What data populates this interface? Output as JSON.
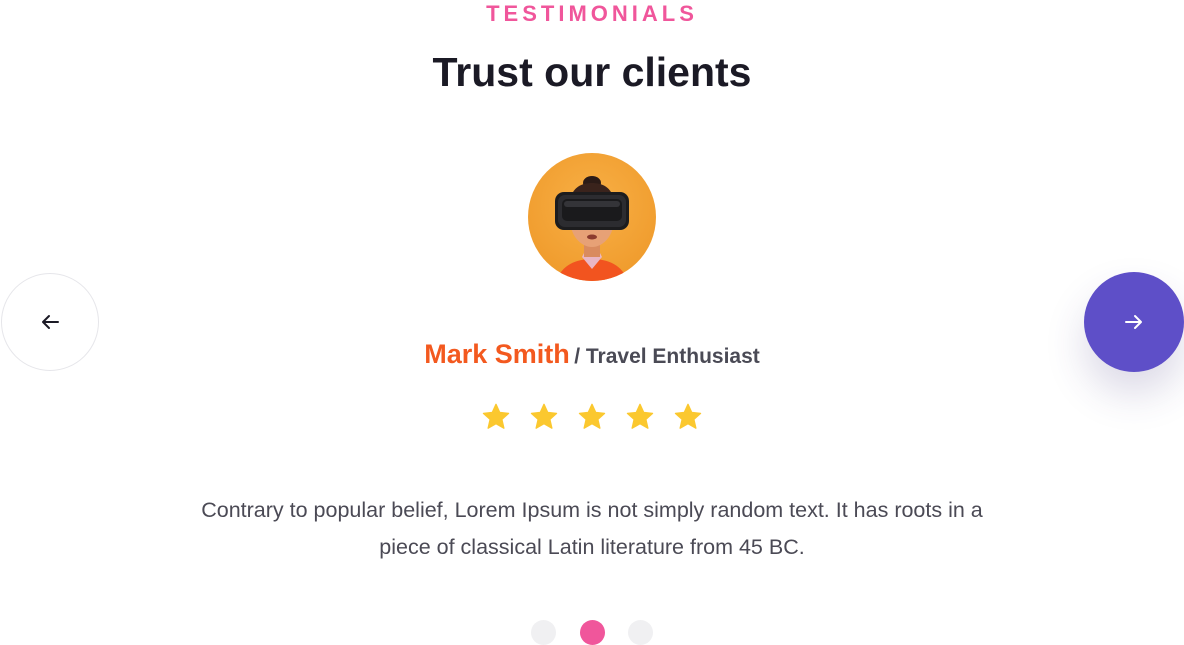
{
  "section": {
    "eyebrow": "TESTIMONIALS",
    "title": "Trust our clients"
  },
  "testimonial": {
    "name": "Mark Smith",
    "role": "/ Travel Enthusiast",
    "rating": 5,
    "rating_max": 5,
    "quote": "Contrary to popular belief, Lorem Ipsum is not simply random text. It has roots in a piece of classical Latin literature from 45 BC."
  },
  "carousel": {
    "prev_icon": "arrow-left-icon",
    "next_icon": "arrow-right-icon",
    "slides": 3,
    "active_slide": 2
  },
  "colors": {
    "accent_pink": "#f0569b",
    "name_orange": "#f3591f",
    "button_purple": "#5e4fc8",
    "star_yellow": "#fbc82f"
  }
}
